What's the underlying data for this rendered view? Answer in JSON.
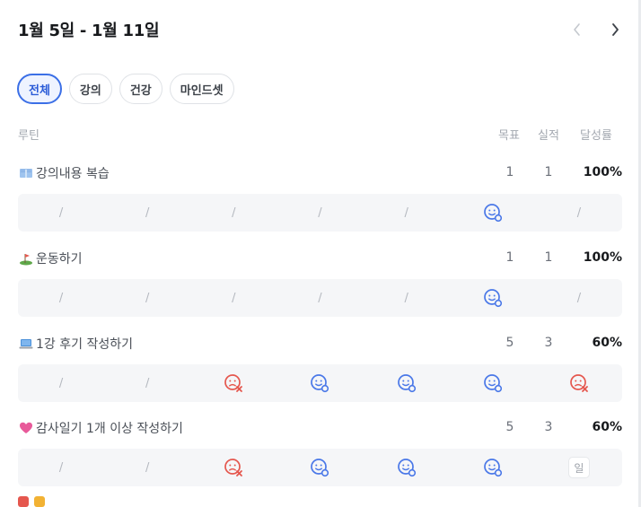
{
  "header": {
    "title": "1월 5일 - 1월 11일"
  },
  "tabs": [
    "전체",
    "강의",
    "건강",
    "마인드셋"
  ],
  "columns": {
    "routine": "루틴",
    "goal": "목표",
    "actual": "실적",
    "rate": "달성률"
  },
  "routines": [
    {
      "name": "강의내용 복습",
      "icon": "book-icon",
      "goal": "1",
      "actual": "1",
      "rate": "100%",
      "days": [
        "/",
        "/",
        "/",
        "/",
        "/",
        "success",
        "/"
      ]
    },
    {
      "name": "운동하기",
      "icon": "golf-flag-icon",
      "goal": "1",
      "actual": "1",
      "rate": "100%",
      "days": [
        "/",
        "/",
        "/",
        "/",
        "/",
        "success",
        "/"
      ]
    },
    {
      "name": "1강 후기 작성하기",
      "icon": "laptop-icon",
      "goal": "5",
      "actual": "3",
      "rate": "60%",
      "days": [
        "/",
        "/",
        "fail",
        "success",
        "success",
        "success",
        "fail"
      ]
    },
    {
      "name": "감사일기 1개 이상 작성하기",
      "icon": "heart-icon",
      "goal": "5",
      "actual": "3",
      "rate": "60%",
      "days": [
        "/",
        "/",
        "fail",
        "success",
        "success",
        "success",
        "일"
      ]
    }
  ],
  "colors": {
    "accent": "#3b6fe6",
    "success": "#4a78e8",
    "fail": "#e5574e"
  }
}
